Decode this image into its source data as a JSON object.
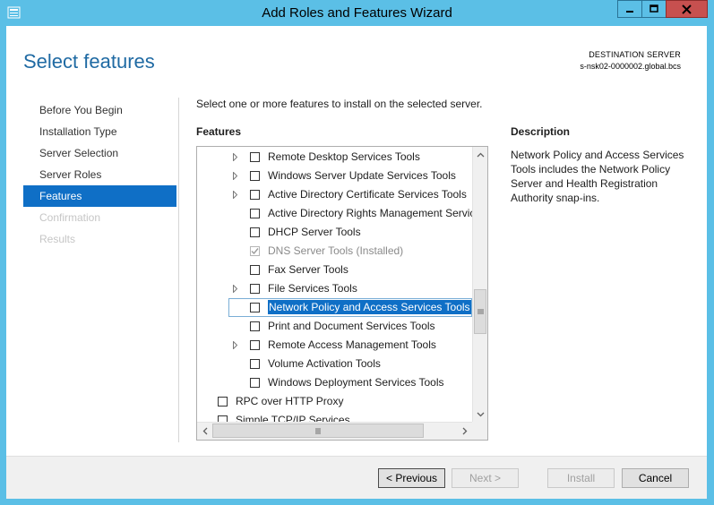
{
  "window": {
    "title": "Add Roles and Features Wizard",
    "colors": {
      "chrome": "#5bbfe6",
      "close": "#c7504f",
      "accent": "#0f6fc6"
    }
  },
  "header": {
    "page_title": "Select features",
    "destination_label": "DESTINATION SERVER",
    "destination_server": "s-nsk02-0000002.global.bcs"
  },
  "nav": {
    "items": [
      {
        "label": "Before You Begin",
        "state": "normal"
      },
      {
        "label": "Installation Type",
        "state": "normal"
      },
      {
        "label": "Server Selection",
        "state": "normal"
      },
      {
        "label": "Server Roles",
        "state": "normal"
      },
      {
        "label": "Features",
        "state": "active"
      },
      {
        "label": "Confirmation",
        "state": "disabled"
      },
      {
        "label": "Results",
        "state": "disabled"
      }
    ]
  },
  "main": {
    "intro": "Select one or more features to install on the selected server.",
    "features_heading": "Features",
    "description_heading": "Description",
    "description_text": "Network Policy and Access Services Tools includes the Network Policy Server and Health Registration Authority snap-ins."
  },
  "features": [
    {
      "label": "Remote Desktop Services Tools",
      "checked": false,
      "expandable": true
    },
    {
      "label": "Windows Server Update Services Tools",
      "checked": false,
      "expandable": true
    },
    {
      "label": "Active Directory Certificate Services Tools",
      "checked": false,
      "expandable": true
    },
    {
      "label": "Active Directory Rights Management Servic",
      "checked": false,
      "expandable": false
    },
    {
      "label": "DHCP Server Tools",
      "checked": false,
      "expandable": false
    },
    {
      "label": "DNS Server Tools (Installed)",
      "checked": true,
      "expandable": false,
      "disabled": true
    },
    {
      "label": "Fax Server Tools",
      "checked": false,
      "expandable": false
    },
    {
      "label": "File Services Tools",
      "checked": false,
      "expandable": true
    },
    {
      "label": "Network Policy and Access Services Tools",
      "checked": false,
      "expandable": false,
      "selected": true
    },
    {
      "label": "Print and Document Services Tools",
      "checked": false,
      "expandable": false
    },
    {
      "label": "Remote Access Management Tools",
      "checked": false,
      "expandable": true
    },
    {
      "label": "Volume Activation Tools",
      "checked": false,
      "expandable": false
    },
    {
      "label": "Windows Deployment Services Tools",
      "checked": false,
      "expandable": false
    },
    {
      "label": "RPC over HTTP Proxy",
      "checked": false,
      "expandable": false,
      "top_level": true
    },
    {
      "label": "Simple TCP/IP Services",
      "checked": false,
      "expandable": false,
      "top_level": true
    }
  ],
  "buttons": {
    "previous": "< Previous",
    "next": "Next >",
    "install": "Install",
    "cancel": "Cancel"
  }
}
